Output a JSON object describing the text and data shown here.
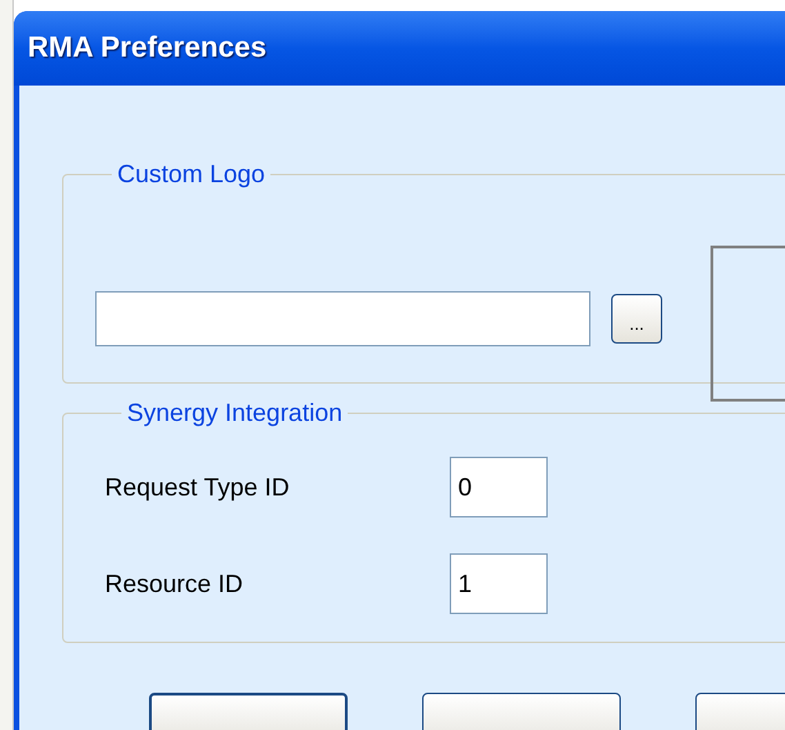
{
  "window": {
    "title": "RMA Preferences"
  },
  "custom_logo": {
    "title": "Custom Logo",
    "browse_button": "..."
  },
  "synergy": {
    "title": "Synergy Integration",
    "fields": [
      {
        "label": "Request Type ID",
        "value": "0"
      },
      {
        "label": "Resource ID",
        "value": "1"
      }
    ]
  }
}
